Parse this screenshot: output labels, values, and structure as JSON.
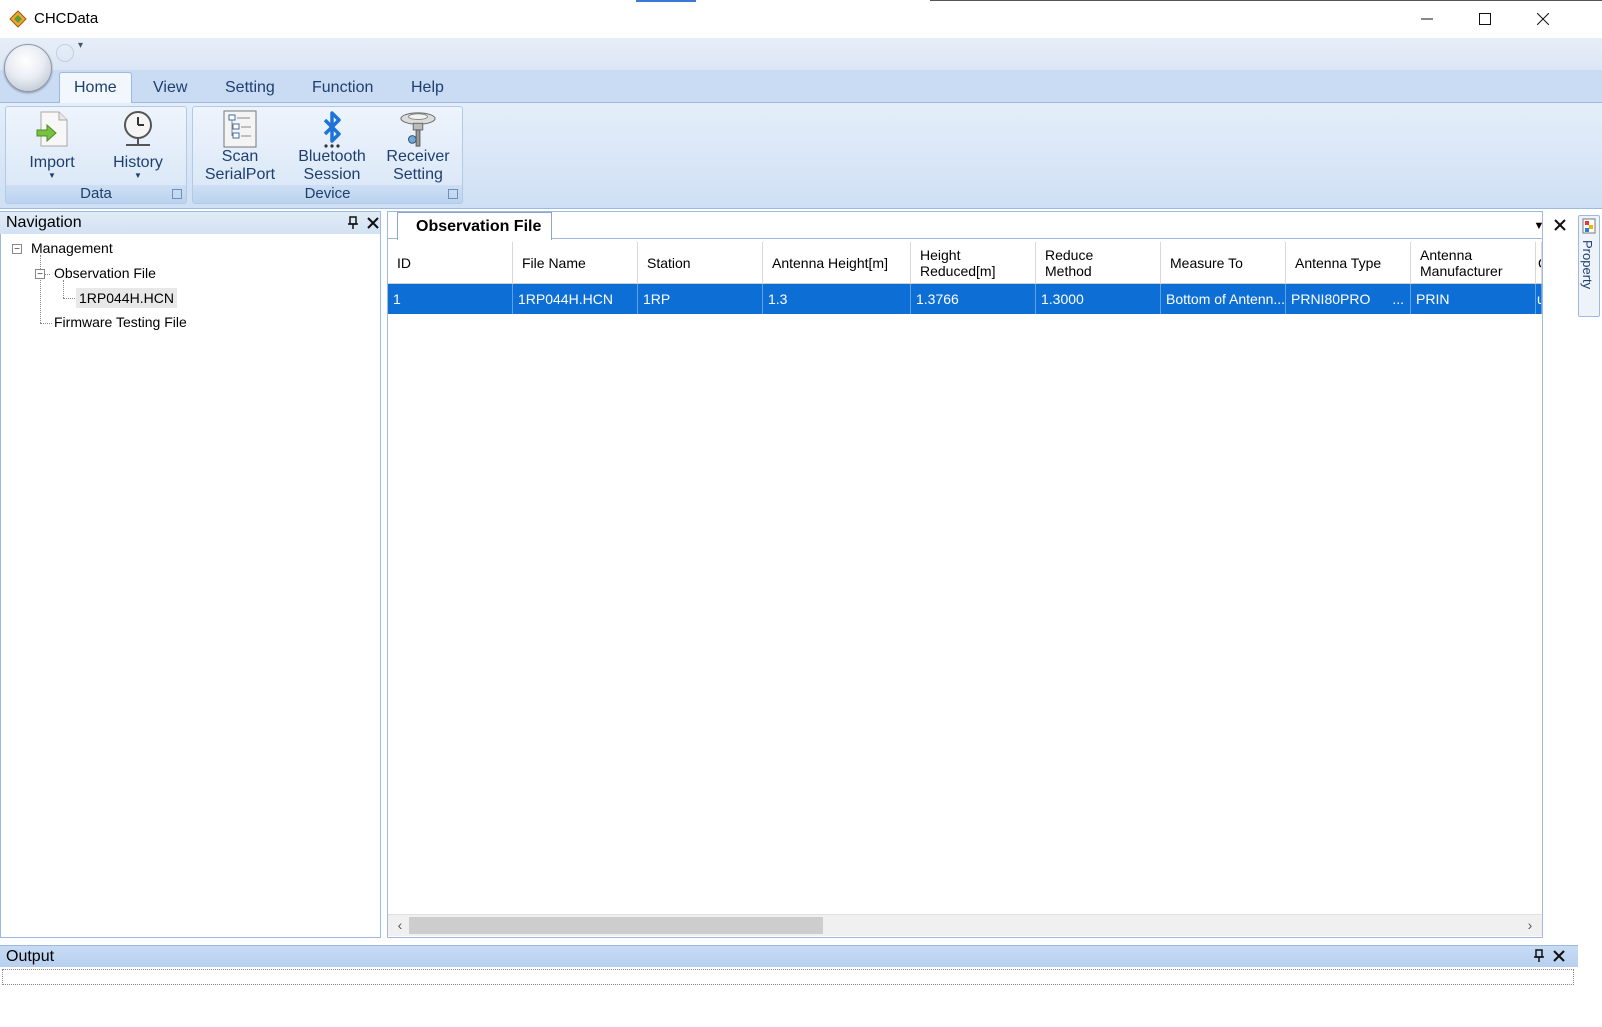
{
  "window": {
    "title": "CHCData",
    "minimize_icon": "minimize-icon",
    "maximize_icon": "maximize-icon",
    "close_icon": "close-icon"
  },
  "ribbon": {
    "tabs": [
      "Home",
      "View",
      "Setting",
      "Function",
      "Help"
    ],
    "active_tab": "Home",
    "groups": {
      "data": {
        "label": "Data",
        "buttons": [
          {
            "label": "Import",
            "icon": "import-icon"
          },
          {
            "label": "History",
            "icon": "history-icon"
          }
        ]
      },
      "device": {
        "label": "Device",
        "buttons": [
          {
            "line1": "Scan",
            "line2": "SerialPort",
            "icon": "scan-serialport-icon"
          },
          {
            "line1": "Bluetooth",
            "line2": "Session",
            "icon": "bluetooth-icon"
          },
          {
            "line1": "Receiver",
            "line2": "Setting",
            "icon": "receiver-icon"
          }
        ]
      }
    }
  },
  "navigation": {
    "title": "Navigation",
    "tree": {
      "root": "Management",
      "observation_file": "Observation File",
      "observation_child": "1RP044H.HCN",
      "firmware": "Firmware Testing File"
    }
  },
  "document": {
    "tab_title": "Observation File",
    "columns": [
      {
        "l1": "ID",
        "l2": ""
      },
      {
        "l1": "File Name",
        "l2": ""
      },
      {
        "l1": "Station",
        "l2": ""
      },
      {
        "l1": "Antenna Height[m]",
        "l2": ""
      },
      {
        "l1": "Height",
        "l2": "Reduced[m]"
      },
      {
        "l1": "Reduce",
        "l2": "Method"
      },
      {
        "l1": "Measure To",
        "l2": ""
      },
      {
        "l1": "Antenna Type",
        "l2": ""
      },
      {
        "l1": "Antenna",
        "l2": "Manufacturer"
      },
      {
        "l1": "QC",
        "l2": ""
      }
    ],
    "rows": [
      {
        "id": "1",
        "file_name": "1RP044H.HCN",
        "station": "1RP",
        "antenna_height": "1.3",
        "height_reduced": "1.3766",
        "reduce_method": "1.3000",
        "measure_to": "Bottom of Antenn...",
        "antenna_type": "PRNI80PRO",
        "antenna_type_ellipsis": "...",
        "manufacturer": "PRIN",
        "qc": "unse"
      }
    ],
    "selected_row": 0
  },
  "property_panel": {
    "label": "Property"
  },
  "output": {
    "title": "Output"
  },
  "colors": {
    "selection": "#0d6fd6",
    "ribbon": "#c9dcf4",
    "panel_border": "#9db9df"
  }
}
